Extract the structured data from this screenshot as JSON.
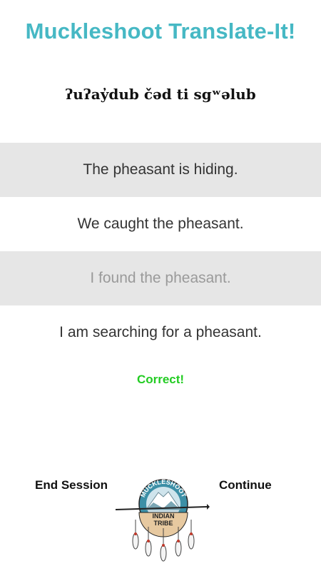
{
  "app": {
    "title": "Muckleshoot Translate-It!"
  },
  "quiz": {
    "prompt": "ʔuʔay̓dub čəd ti sgʷəlub",
    "options": [
      {
        "text": "The pheasant is hiding.",
        "state": "default"
      },
      {
        "text": "We caught the pheasant.",
        "state": "default"
      },
      {
        "text": "I found the pheasant.",
        "state": "selected"
      },
      {
        "text": "I am searching for a pheasant.",
        "state": "default"
      }
    ],
    "feedback": "Correct!"
  },
  "footer": {
    "end_label": "End Session",
    "continue_label": "Continue",
    "logo": {
      "top_text": "MUCKLESHOOT",
      "line1": "INDIAN",
      "line2": "TRIBE"
    }
  },
  "colors": {
    "title": "#46b8c4",
    "option_shade": "#e6e6e6",
    "selected_text": "#9a9a9a",
    "correct": "#22cc22"
  }
}
